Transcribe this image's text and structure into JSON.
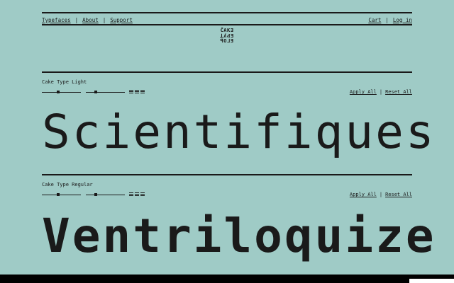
{
  "nav": {
    "left": [
      "Typefaces",
      "About",
      "Support"
    ],
    "right": [
      "Cart",
      "Log in"
    ],
    "separator": "|"
  },
  "logo": {
    "lines": [
      "ČAKƎ",
      "ꓕʎԀƎ",
      "ꟼOᒧƎ"
    ]
  },
  "sections": [
    {
      "label": "Cake Type Light",
      "apply": "Apply All",
      "reset": "Reset All",
      "specimen": "Scientifiques"
    },
    {
      "label": "Cake Type Regular",
      "apply": "Apply All",
      "reset": "Reset All",
      "specimen": "Ventriloquize"
    }
  ],
  "colors": {
    "background": "#9fcbc6",
    "ink": "#1a1a1a"
  }
}
